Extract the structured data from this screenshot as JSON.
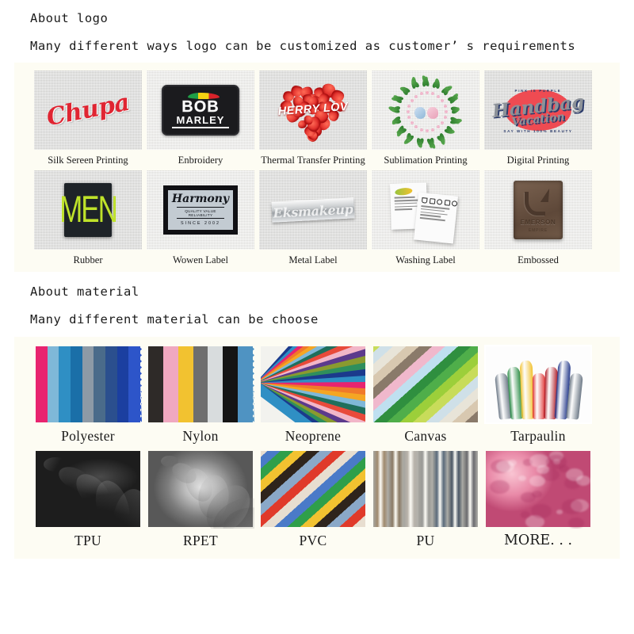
{
  "logo_section": {
    "title": "About logo",
    "subtitle": "Many different ways logo can be customized as customer’ s requirements",
    "items": [
      {
        "caption": "Silk Sereen Printing",
        "art": "chupa",
        "logo_text": "Chupa"
      },
      {
        "caption": "Enbroidery",
        "art": "bob-marley",
        "logo_text_1": "BOB",
        "logo_text_2": "MARLEY",
        "logo_text_3": "™"
      },
      {
        "caption": "Thermal Transfer Printing",
        "art": "strawberry-heart",
        "logo_text": "HERRY LOV"
      },
      {
        "caption": "Sublimation Printing",
        "art": "leaf-wreath-birds"
      },
      {
        "caption": "Digital Printing",
        "art": "handbag-script",
        "logo_text_1": "Handbag",
        "logo_text_2": "Vacation",
        "logo_text_top": "PINK IS PURPLE",
        "logo_text_bottom": "SAY WITH 100% BEAUTY"
      },
      {
        "caption": "Rubber",
        "art": "men-rubber-patch",
        "logo_text": "MEN"
      },
      {
        "caption": "Wowen Label",
        "art": "harmony-woven-label",
        "logo_text_1": "Harmony",
        "logo_text_2": "QUALITY VALUE RELIABILITY",
        "logo_text_3": "SINCE 2002"
      },
      {
        "caption": "Metal Label",
        "art": "metal-script",
        "logo_text": "Eksmakeup"
      },
      {
        "caption": "Washing Label",
        "art": "care-labels"
      },
      {
        "caption": "Embossed",
        "art": "leather-emboss",
        "logo_text_1": "EMERSON",
        "logo_text_2": "EMPIRE"
      }
    ]
  },
  "material_section": {
    "title": "About material",
    "subtitle": "Many different material can be choose",
    "items": [
      {
        "caption": "Polyester",
        "art": "vertical-color-stripes",
        "colors": [
          "#e8246f",
          "#7fb8d8",
          "#2f8fc4",
          "#1a6fa8",
          "#8d9aa6",
          "#4a6b8a",
          "#2b4f8e",
          "#1b3fa0",
          "#2d55c9"
        ]
      },
      {
        "caption": "Nylon",
        "art": "vertical-color-stripes",
        "colors": [
          "#2e2a28",
          "#f0a8c0",
          "#f2c230",
          "#6e6e6e",
          "#d8dcdd",
          "#151515",
          "#4f93c2"
        ]
      },
      {
        "caption": "Neoprene",
        "art": "radial-color-fan",
        "colors": [
          "#1b3a8c",
          "#2f8fc4",
          "#e8246f",
          "#f07a2a",
          "#f5a623",
          "#7fb8d8",
          "#1f6f5c",
          "#e84a3a",
          "#f2b6c8",
          "#5c3a8c",
          "#8a9a2f",
          "#2f8f5c"
        ]
      },
      {
        "caption": "Canvas",
        "art": "diagonal-color-stripes",
        "colors": [
          "#8a7a6a",
          "#d8c8b0",
          "#e8e4d8",
          "#cfe0e8",
          "#c8dc5a",
          "#9ccf3a",
          "#4fae4a",
          "#2f8f3f",
          "#bfe0f0",
          "#f0b8cc"
        ]
      },
      {
        "caption": "Tarpaulin",
        "art": "rolled-sheets",
        "colors": [
          "#6e7a88",
          "#2f8f4a",
          "#f2c230",
          "#e03a3a",
          "#b01f2a",
          "#2b3f8e",
          "#6e7a88"
        ]
      },
      {
        "caption": "TPU",
        "art": "glossy-black-sheet",
        "colors": [
          "#1a1a1a",
          "#3a3a3a"
        ]
      },
      {
        "caption": "RPET",
        "art": "gray-swirled-fabric",
        "colors": [
          "#8a8a8a",
          "#d8d8d8",
          "#4a4a4a"
        ]
      },
      {
        "caption": "PVC",
        "art": "diagonal-color-stripes",
        "colors": [
          "#e8ded0",
          "#e03a2a",
          "#8aa8c8",
          "#2e241c",
          "#f2c230",
          "#2f9f4a",
          "#4a7ac8"
        ]
      },
      {
        "caption": "PU",
        "art": "rolled-leather-bolts",
        "colors": [
          "#a08a6e",
          "#8a7a64",
          "#b8b2aa",
          "#9a9a96",
          "#5a6a7a",
          "#4a5664",
          "#6a6a6e"
        ]
      },
      {
        "caption": "MORE. . .",
        "art": "pink-fur",
        "colors": [
          "#f0a8c0",
          "#c04a74"
        ]
      }
    ]
  }
}
